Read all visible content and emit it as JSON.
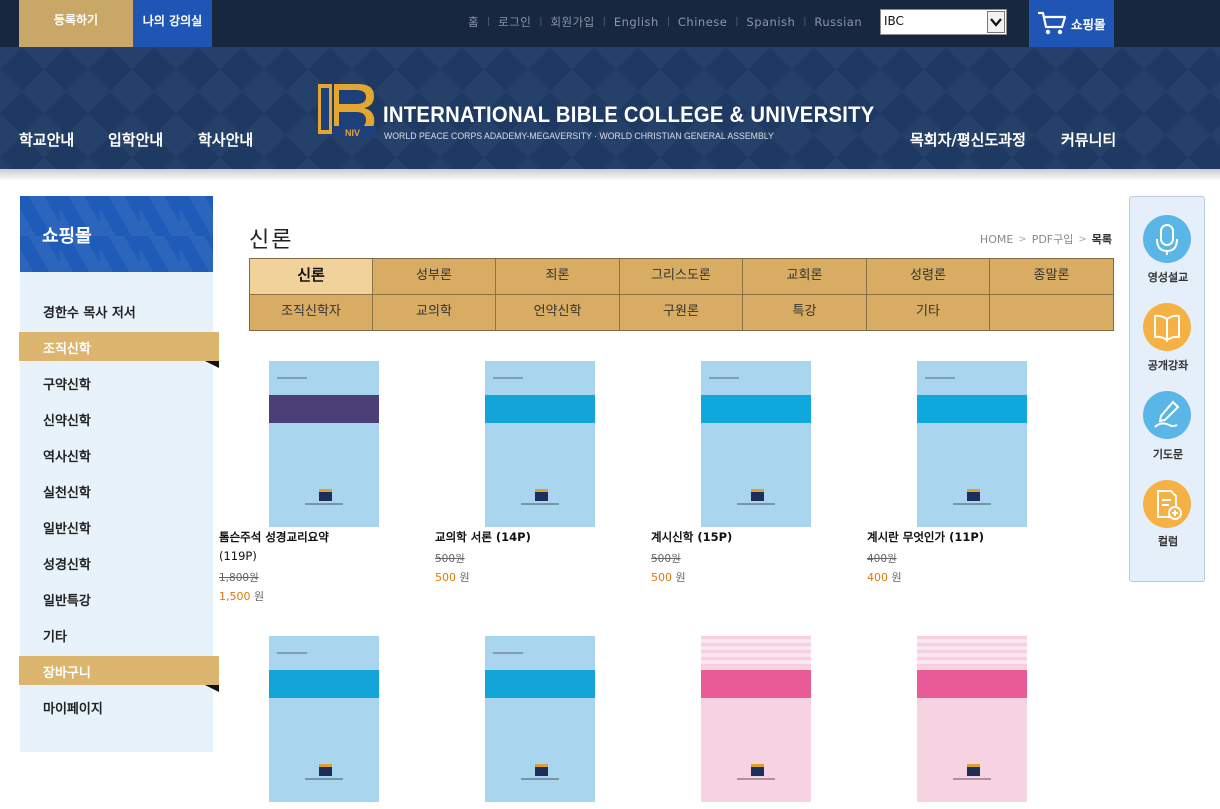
{
  "topbar": {
    "register_label": "등록하기",
    "myclass_label": "나의 강의실",
    "links": [
      "홈",
      "로그인",
      "회원가입",
      "English",
      "Chinese",
      "Spanish",
      "Russian"
    ],
    "select_value": "IBC",
    "shop_label": "쇼핑몰"
  },
  "header": {
    "nav_left": [
      "학교안내",
      "입학안내",
      "학사안내"
    ],
    "nav_right": [
      "목회자/평신도과정",
      "커뮤니티"
    ],
    "logo_title": "INTERNATIONAL BIBLE COLLEGE & UNIVERSITY",
    "logo_subtitle": "WORLD PEACE CORPS ADADEMY-MEGAVERSITY · WORLD CHRISTIAN GENERAL ASSEMBLY"
  },
  "sidebar": {
    "title": "쇼핑몰",
    "items": [
      "경한수 목사 저서",
      "조직신학",
      "구약신학",
      "신약신학",
      "역사신학",
      "실천신학",
      "일반신학",
      "성경신학",
      "일반특강",
      "기타",
      "장바구니",
      "마이페이지"
    ],
    "active_items": [
      "조직신학",
      "장바구니"
    ]
  },
  "main": {
    "page_title": "신론",
    "breadcrumb": [
      "HOME",
      "PDF구입",
      "목록"
    ],
    "categories_row1": [
      "신론",
      "성부론",
      "죄론",
      "그리스도론",
      "교회론",
      "성령론",
      "종말론"
    ],
    "categories_row2": [
      "조직신학자",
      "교의학",
      "언약신학",
      "구원론",
      "특강",
      "기타",
      ""
    ],
    "active_category": "신론",
    "currency": "원",
    "products": [
      {
        "name_lines": [
          "톰슨주석 성경교리요약",
          "(119P)"
        ],
        "old_price": "1,800원",
        "price": "1,500",
        "cover_band": "#4b3f78",
        "cover_bg": "#a9d6ee"
      },
      {
        "name_lines": [
          "교의학 서론 (14P)"
        ],
        "old_price": "500원",
        "price": "500",
        "cover_band": "#13a4d9",
        "cover_bg": "#a9d6ee"
      },
      {
        "name_lines": [
          "계시신학 (15P)"
        ],
        "old_price": "500원",
        "price": "500",
        "cover_band": "#0ea8dc",
        "cover_bg": "#a9d6ee"
      },
      {
        "name_lines": [
          "계시란 무엇인가 (11P)"
        ],
        "old_price": "400원",
        "price": "400",
        "cover_band": "#0ea8dc",
        "cover_bg": "#a9d6ee"
      },
      {
        "name_lines": [],
        "old_price": "",
        "price": "",
        "cover_band": "#13a4d9",
        "cover_bg": "#a9d6ee"
      },
      {
        "name_lines": [],
        "old_price": "",
        "price": "",
        "cover_band": "#13a4d9",
        "cover_bg": "#a9d6ee"
      },
      {
        "name_lines": [],
        "old_price": "",
        "price": "",
        "cover_band": "#e85b96",
        "cover_bg": "#f7d3e2"
      },
      {
        "name_lines": [],
        "old_price": "",
        "price": "",
        "cover_band": "#e85b96",
        "cover_bg": "#f7d3e2"
      }
    ]
  },
  "quickmenu": {
    "items": [
      {
        "label": "영성설교",
        "icon": "microphone-icon"
      },
      {
        "label": "공개강좌",
        "icon": "book-icon"
      },
      {
        "label": "기도문",
        "icon": "pen-hand-icon"
      },
      {
        "label": "컬럼",
        "icon": "document-plus-icon"
      }
    ]
  },
  "colors": {
    "topbar_bg": "#16273f",
    "gold": "#c9a767",
    "blue": "#1f55b5",
    "header_bg": "#1e3a63",
    "category_bg": "#d8ac62",
    "price_accent": "#e0790b",
    "quick_circle_blue": "#5ab6e6",
    "quick_circle_orange": "#f6b145"
  }
}
